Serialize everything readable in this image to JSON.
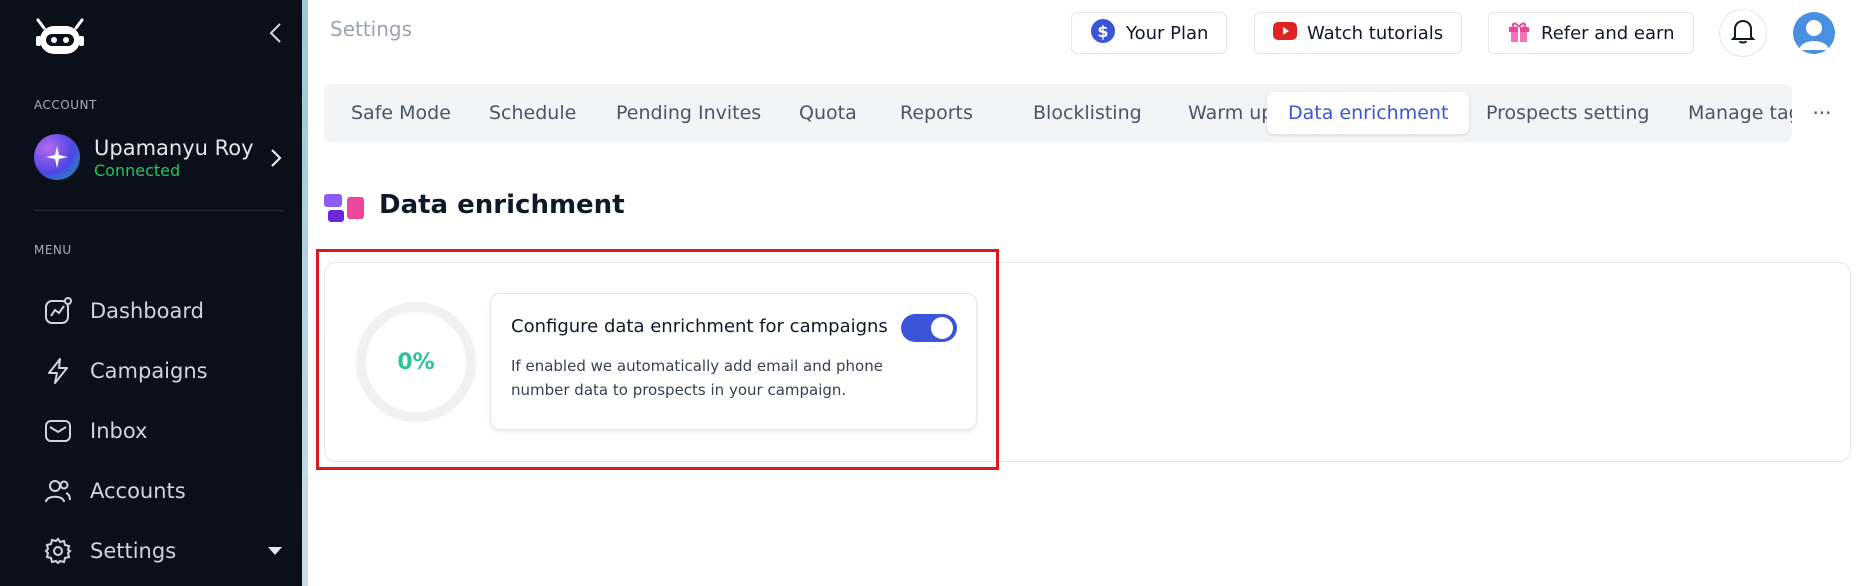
{
  "sidebar": {
    "account_label": "ACCOUNT",
    "account": {
      "name": "Upamanyu Roy",
      "status": "Connected"
    },
    "menu_label": "MENU",
    "items": [
      {
        "label": "Dashboard",
        "icon": "dashboard-icon"
      },
      {
        "label": "Campaigns",
        "icon": "lightning-icon"
      },
      {
        "label": "Inbox",
        "icon": "inbox-icon"
      },
      {
        "label": "Accounts",
        "icon": "users-icon"
      },
      {
        "label": "Settings",
        "icon": "gear-icon"
      }
    ]
  },
  "header": {
    "title": "Settings",
    "buttons": [
      {
        "label": "Your Plan",
        "icon": "dollar-icon"
      },
      {
        "label": "Watch tutorials",
        "icon": "youtube-icon"
      },
      {
        "label": "Refer and earn",
        "icon": "gift-icon"
      }
    ]
  },
  "tabs": [
    {
      "label": "Safe Mode"
    },
    {
      "label": "Schedule"
    },
    {
      "label": "Pending Invites"
    },
    {
      "label": "Quota"
    },
    {
      "label": "Reports"
    },
    {
      "label": "Blocklisting"
    },
    {
      "label": "Warm up"
    },
    {
      "label": "Data enrichment",
      "active": true
    },
    {
      "label": "Prospects setting"
    },
    {
      "label": "Manage tags"
    }
  ],
  "tabs_more": "···",
  "section": {
    "title": "Data enrichment",
    "progress_text": "0%",
    "progress_value": 0,
    "config": {
      "title": "Configure data enrichment for campaigns",
      "description": "If enabled we automatically add email and phone number data to prospects in your campaign.",
      "enabled": true
    }
  },
  "colors": {
    "sidebar_bg": "#0b0f19",
    "accent": "#3b55d9",
    "connected": "#22c55e",
    "progress": "#2bc39a",
    "highlight": "#d81b1b"
  }
}
